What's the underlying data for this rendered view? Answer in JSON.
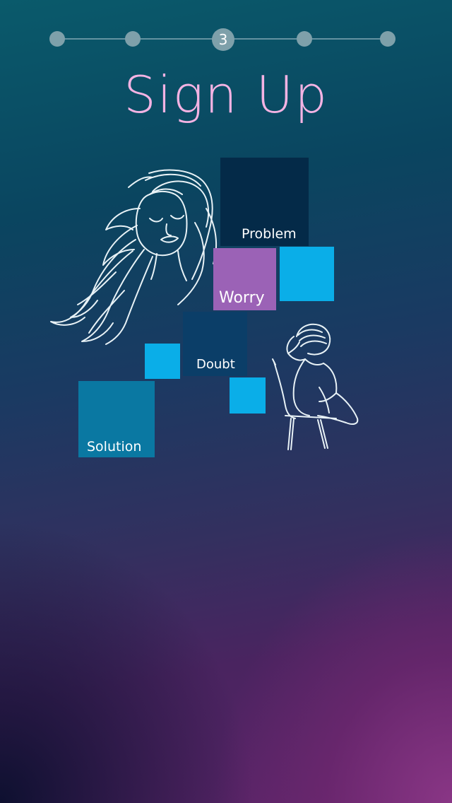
{
  "stepper": {
    "current_step": "3",
    "total_steps": 5
  },
  "header": {
    "title": "Sign Up"
  },
  "illustration": {
    "tiles": {
      "problem": "Problem",
      "worry": "Worry",
      "doubt": "Doubt",
      "solution": "Solution"
    }
  },
  "colors": {
    "title": "#f4b3e3",
    "step_dot": "#7ea0aa",
    "problem_tile": "#042a48",
    "worry_tile": "#9b62b6",
    "doubt_tile": "#0b3e68",
    "solution_tile": "#0a78a2",
    "accent_tile": "#0aaee8"
  }
}
